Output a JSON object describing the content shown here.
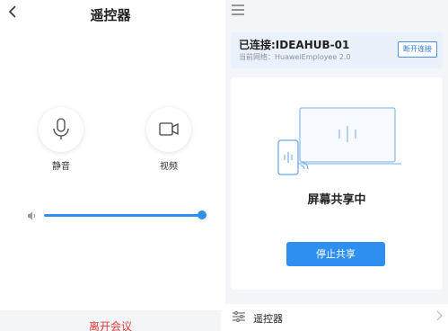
{
  "left": {
    "title": "遥控器",
    "back_icon": "chevron-left-icon",
    "mute_label": "静音",
    "video_label": "视频",
    "volume_level": 1.0,
    "leave_label": "离开会议"
  },
  "right": {
    "menu_icon": "hamburger-icon",
    "connection": {
      "title": "已连接:IDEAHUB-01",
      "network": "当前网络：HuaweiEmployee 2.0",
      "disconnect_label": "断开连接"
    },
    "share": {
      "status": "屏幕共享中",
      "stop_label": "停止共享"
    },
    "remote_row": {
      "label": "遥控器",
      "icon": "sliders-icon"
    }
  },
  "colors": {
    "accent": "#2e8ff0",
    "danger": "#e23a3a",
    "panel_bg": "#f4f5f8"
  }
}
